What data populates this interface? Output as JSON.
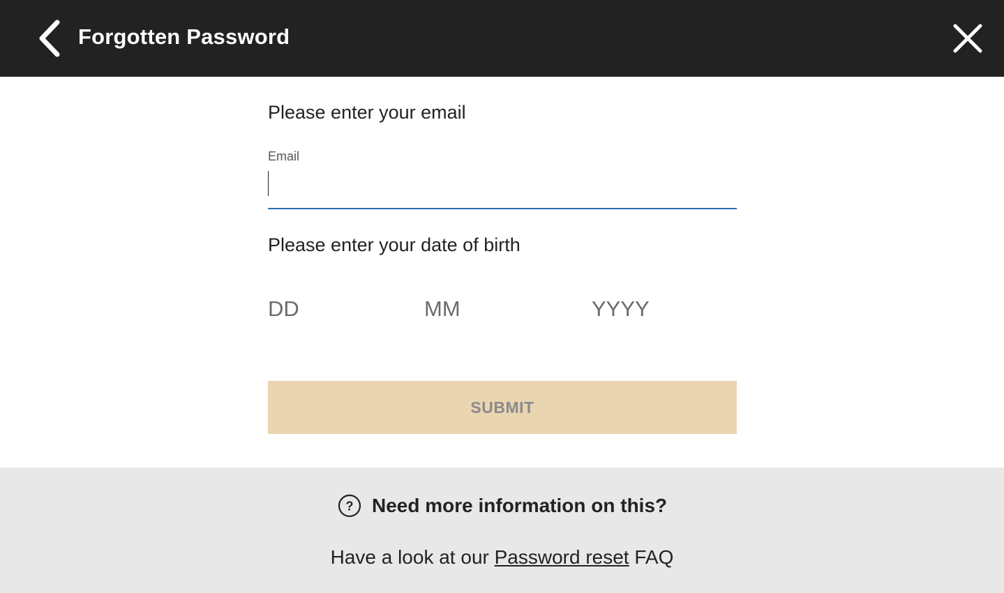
{
  "header": {
    "back_icon": "chevron-left-icon",
    "title": "Forgotten Password",
    "close_icon": "close-icon"
  },
  "form": {
    "email_prompt": "Please enter your email",
    "email_label": "Email",
    "email_value": "",
    "dob_prompt": "Please enter your date of birth",
    "dob_day_placeholder": "DD",
    "dob_month_placeholder": "MM",
    "dob_year_placeholder": "YYYY",
    "submit_label": "SUBMIT"
  },
  "help": {
    "icon": "question-circle-icon",
    "title": "Need more information on this?",
    "text_before": "Have a look at our ",
    "link_text": "Password reset",
    "text_after": " FAQ"
  },
  "colors": {
    "header_bg": "#222222",
    "input_underline": "#2a6fb0",
    "submit_bg": "#ead5b1",
    "submit_text": "#8a8a8a",
    "help_bg": "#e8e8e8"
  }
}
